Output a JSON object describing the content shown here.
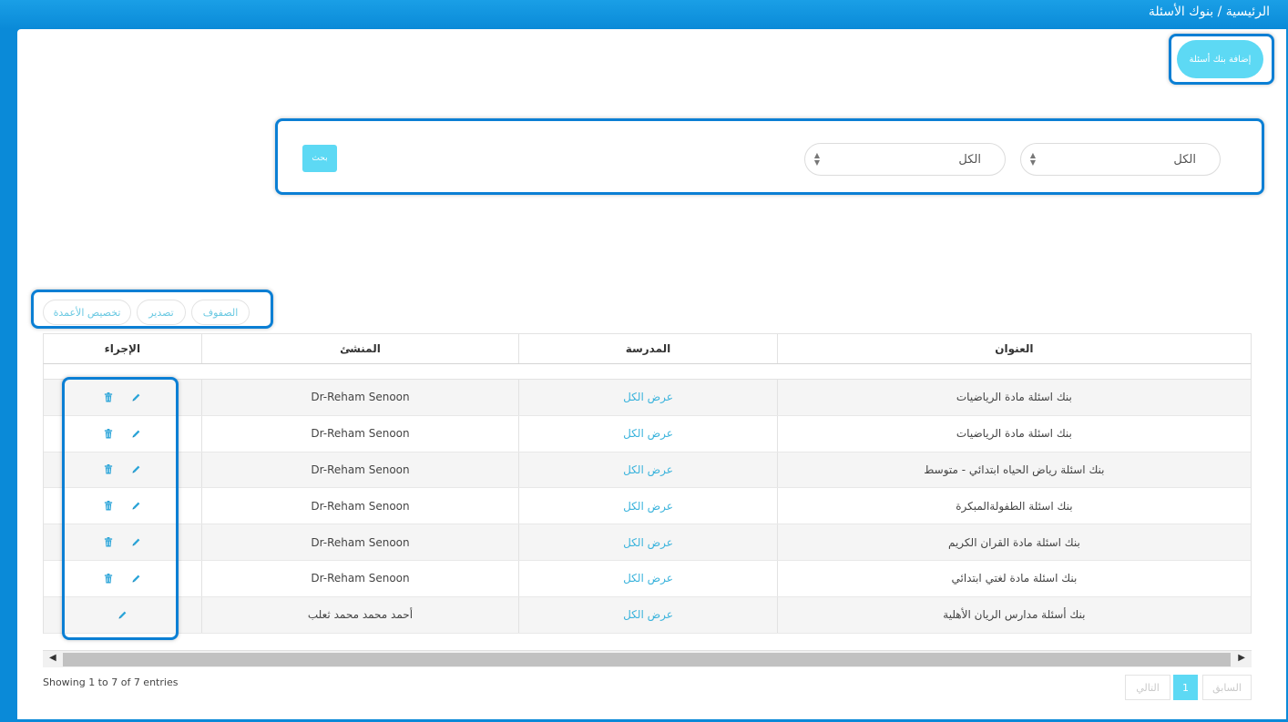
{
  "breadcrumb": "الرئيسية / بنوك الأسئلة",
  "add_button": "إضافة بنك أسئلة",
  "filters": {
    "select1": "الكل",
    "select2": "الكل",
    "search_button": "بحث"
  },
  "toolbar": {
    "rows": "الصفوف",
    "export": "تصدير",
    "customize_columns": "تخصيص الأعمدة"
  },
  "table": {
    "headers": {
      "title": "العنوان",
      "school": "المدرسة",
      "creator": "المنشئ",
      "action": "الإجراء"
    },
    "rows": [
      {
        "title": "بنك اسئلة مادة الرياضيات",
        "school": "عرض الكل",
        "creator": "Dr-Reham Senoon",
        "delete": true
      },
      {
        "title": "بنك اسئلة مادة الرياضيات",
        "school": "عرض الكل",
        "creator": "Dr-Reham Senoon",
        "delete": true
      },
      {
        "title": "بنك اسئلة رياض الحياه ابتدائي - متوسط",
        "school": "عرض الكل",
        "creator": "Dr-Reham Senoon",
        "delete": true
      },
      {
        "title": "بنك اسئلة الطفولةالمبكرة",
        "school": "عرض الكل",
        "creator": "Dr-Reham Senoon",
        "delete": true
      },
      {
        "title": "بنك اسئلة مادة القران الكريم",
        "school": "عرض الكل",
        "creator": "Dr-Reham Senoon",
        "delete": true
      },
      {
        "title": "بنك اسئلة مادة لغتي ابتدائي",
        "school": "عرض الكل",
        "creator": "Dr-Reham Senoon",
        "delete": true
      },
      {
        "title": "بنك أسئلة مدارس الريان الأهلية",
        "school": "عرض الكل",
        "creator": "أحمد محمد محمد ثعلب",
        "delete": false
      }
    ]
  },
  "info": "Showing 1 to 7 of 7 entries",
  "pagination": {
    "prev": "السابق",
    "page": "1",
    "next": "التالي"
  },
  "icons": {
    "edit": "pencil-icon",
    "delete": "trash-icon"
  },
  "colors": {
    "accent": "#5dd9f4",
    "frame": "#0a8ad8",
    "highlight": "#0b7fd4",
    "link": "#3ab3dc"
  }
}
